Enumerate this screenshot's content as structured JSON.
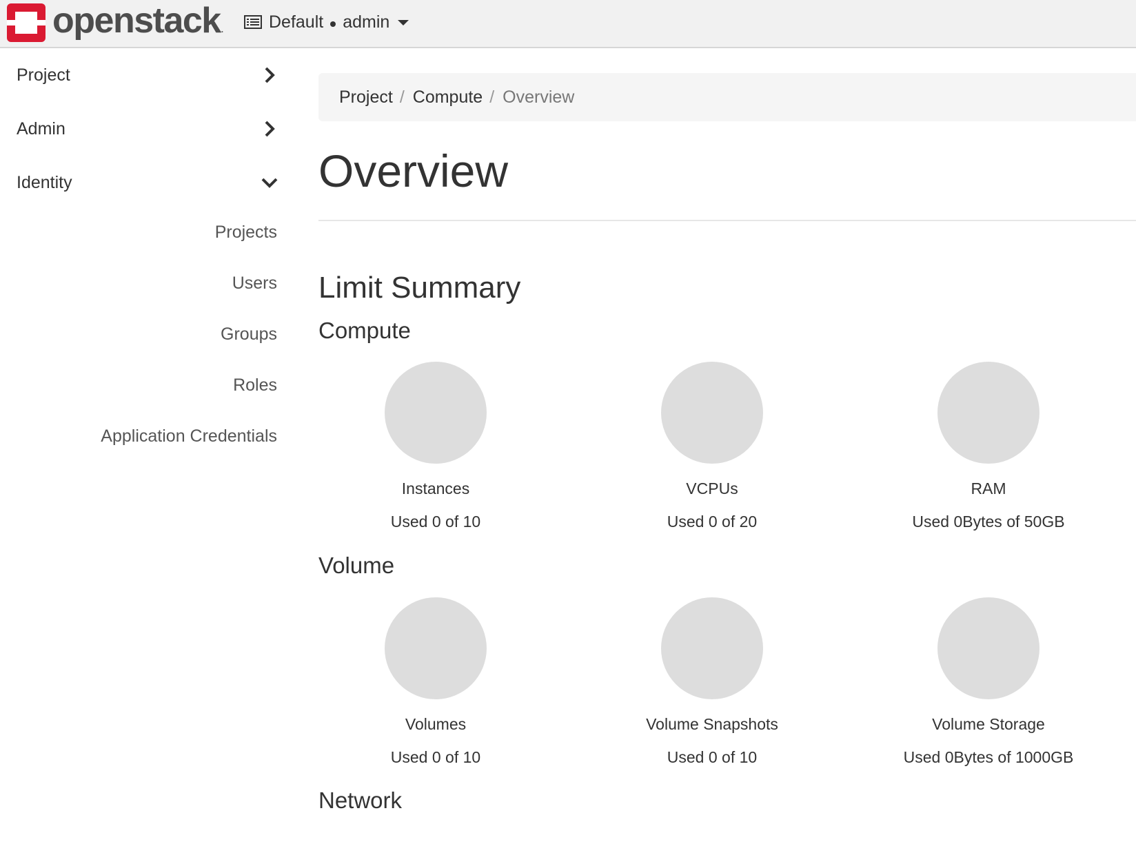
{
  "header": {
    "brand": "openstack",
    "brand_mark": ".",
    "domain": "Default",
    "user": "admin",
    "icons": {
      "logo": "openstack-logo",
      "context": "list-icon",
      "caret": "caret-down-icon"
    },
    "colors": {
      "logo_red": "#da1a32",
      "navbar_bg": "#f1f1f1"
    }
  },
  "sidebar": {
    "sections": [
      {
        "label": "Project",
        "icon": "chevron-right-icon"
      },
      {
        "label": "Admin",
        "icon": "chevron-right-icon"
      },
      {
        "label": "Identity",
        "icon": "chevron-down-icon"
      }
    ],
    "identity_items": [
      "Projects",
      "Users",
      "Groups",
      "Roles",
      "Application Credentials"
    ]
  },
  "breadcrumb": {
    "items": [
      "Project",
      "Compute"
    ],
    "current": "Overview",
    "separator": "/"
  },
  "page": {
    "title": "Overview",
    "limit_summary": "Limit Summary",
    "sections": {
      "compute": {
        "title": "Compute",
        "quotas": [
          {
            "label": "Instances",
            "usage": "Used 0 of 10",
            "fraction": 0
          },
          {
            "label": "VCPUs",
            "usage": "Used 0 of 20",
            "fraction": 0
          },
          {
            "label": "RAM",
            "usage": "Used 0Bytes of 50GB",
            "fraction": 0
          }
        ]
      },
      "volume": {
        "title": "Volume",
        "quotas": [
          {
            "label": "Volumes",
            "usage": "Used 0 of 10",
            "fraction": 0
          },
          {
            "label": "Volume Snapshots",
            "usage": "Used 0 of 10",
            "fraction": 0
          },
          {
            "label": "Volume Storage",
            "usage": "Used 0Bytes of 1000GB",
            "fraction": 0
          }
        ]
      },
      "network": {
        "title": "Network"
      }
    },
    "colors": {
      "pie_empty": "#dddddd"
    }
  }
}
